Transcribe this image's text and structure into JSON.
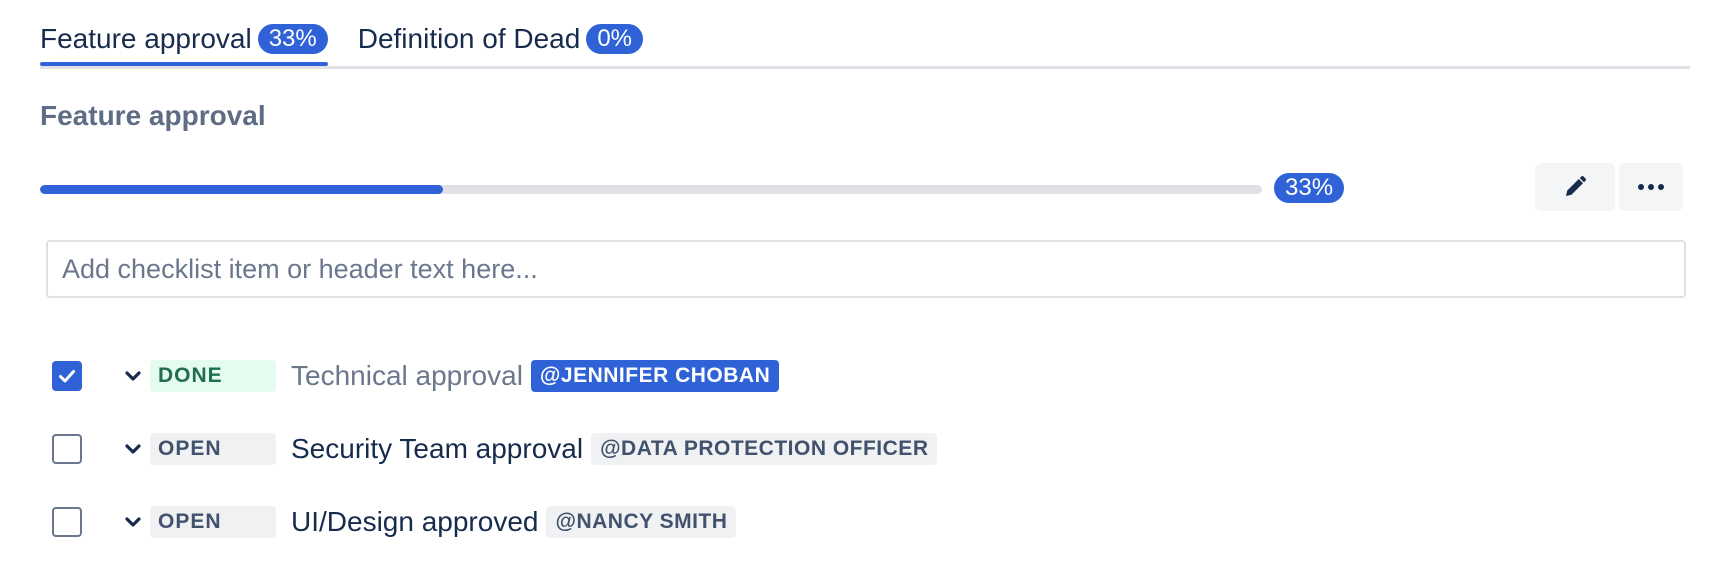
{
  "tabs": [
    {
      "label": "Feature approval",
      "percent": "33%",
      "active": true
    },
    {
      "label": "Definition of Dead",
      "percent": "0%",
      "active": false
    }
  ],
  "section_title": "Feature approval",
  "progress": {
    "value": 0.33,
    "label": "33%"
  },
  "input": {
    "placeholder": "Add checklist item or header text here...",
    "value": ""
  },
  "toolbar": {
    "edit_icon": "pencil-icon",
    "more_icon": "more-icon"
  },
  "items": [
    {
      "checked": true,
      "status": "DONE",
      "label": "Technical approval",
      "mention": "@JENNIFER CHOBAN"
    },
    {
      "checked": false,
      "status": "OPEN",
      "label": "Security Team approval",
      "mention": "@DATA PROTECTION OFFICER"
    },
    {
      "checked": false,
      "status": "OPEN",
      "label": "UI/Design approved",
      "mention": "@NANCY SMITH"
    }
  ],
  "colors": {
    "accent": "#2f62d6",
    "done_bg": "#e3fcef",
    "done_text": "#216e4e",
    "open_bg": "#f0f1f3",
    "track": "#dfe1e6"
  }
}
